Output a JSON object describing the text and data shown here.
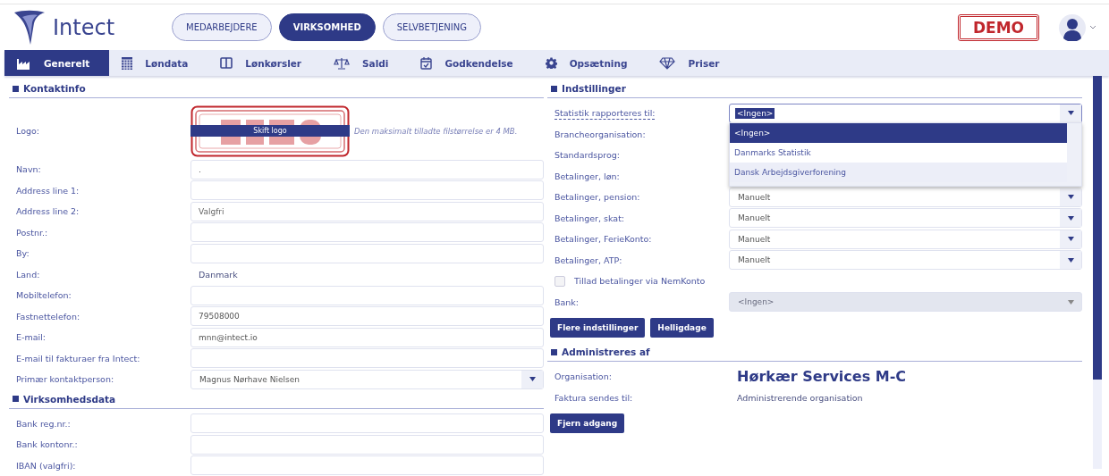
{
  "header": {
    "logo_text": "Intect",
    "demo_badge": "DEMO",
    "nav": [
      {
        "label": "MEDARBEJDERE",
        "selected": false
      },
      {
        "label": "VIRKSOMHED",
        "selected": true
      },
      {
        "label": "SELVBETJENING",
        "selected": false
      }
    ]
  },
  "tabs": [
    {
      "label": "Generelt",
      "selected": true
    },
    {
      "label": "Løndata",
      "selected": false
    },
    {
      "label": "Lønkørsler",
      "selected": false
    },
    {
      "label": "Saldi",
      "selected": false
    },
    {
      "label": "Godkendelse",
      "selected": false
    },
    {
      "label": "Opsætning",
      "selected": false
    },
    {
      "label": "Priser",
      "selected": false
    }
  ],
  "kontaktinfo": {
    "title": "Kontaktinfo",
    "logo": {
      "label": "Logo:",
      "button": "Skift logo",
      "hint": "Den maksimalt tilladte filstørrelse er 4 MB."
    },
    "fields": [
      {
        "label": "Navn:",
        "kind": "input",
        "value": "."
      },
      {
        "label": "Address line 1:",
        "kind": "input"
      },
      {
        "label": "Address line 2:",
        "kind": "input",
        "placeholder": "Valgfri"
      },
      {
        "label": "Postnr.:",
        "kind": "input"
      },
      {
        "label": "By:",
        "kind": "input"
      },
      {
        "label": "Land:",
        "kind": "text",
        "value": "Danmark"
      },
      {
        "label": "Mobiltelefon:",
        "kind": "input"
      },
      {
        "label": "Fastnettelefon:",
        "kind": "input",
        "value": "79508000"
      },
      {
        "label": "E-mail:",
        "kind": "input",
        "value": "mnn@intect.io"
      },
      {
        "label": "E-mail til fakturaer fra Intect:",
        "kind": "input"
      },
      {
        "label": "Primær kontaktperson:",
        "kind": "select",
        "value": "Magnus Nørhave Nielsen"
      }
    ]
  },
  "virksomhedsdata": {
    "title": "Virksomhedsdata",
    "fields": [
      {
        "label": "Bank reg.nr.:",
        "kind": "input"
      },
      {
        "label": "Bank kontonr.:",
        "kind": "input"
      },
      {
        "label": "IBAN (valgfri):",
        "kind": "input"
      }
    ]
  },
  "indstillinger": {
    "title": "Indstillinger",
    "fields": [
      {
        "label": "Statistik rapporteres til:",
        "kind": "open_select",
        "value": "<Ingen>"
      },
      {
        "label": "Brancheorganisation:",
        "kind": "covered"
      },
      {
        "label": "Standardsprog:",
        "kind": "covered"
      },
      {
        "label": "Betalinger, løn:",
        "kind": "covered"
      },
      {
        "label": "Betalinger, pension:",
        "kind": "select",
        "value": "Manuelt"
      },
      {
        "label": "Betalinger, skat:",
        "kind": "select",
        "value": "Manuelt"
      },
      {
        "label": "Betalinger, FerieKonto:",
        "kind": "select",
        "value": "Manuelt"
      },
      {
        "label": "Betalinger, ATP:",
        "kind": "select",
        "value": "Manuelt"
      },
      {
        "label": "Tillad betalinger via NemKonto",
        "kind": "checkbox",
        "checked": false
      },
      {
        "label": "Bank:",
        "kind": "disabled_select",
        "value": "<Ingen>"
      }
    ],
    "dropdown": [
      {
        "label": "<Ingen>",
        "selected": true,
        "highlighted": false
      },
      {
        "label": "Danmarks Statistik",
        "selected": false,
        "highlighted": false
      },
      {
        "label": "Dansk Arbejdsgiverforening",
        "selected": false,
        "highlighted": true
      }
    ],
    "buttons": [
      "Flere indstillinger",
      "Helligdage"
    ]
  },
  "administreres": {
    "title": "Administreres af",
    "organisation": {
      "label": "Organisation:",
      "value": "Hørkær Services M-C"
    },
    "faktura": {
      "label": "Faktura sendes til:",
      "value": "Administrerende organisation"
    },
    "button": "Fjern adgang"
  }
}
